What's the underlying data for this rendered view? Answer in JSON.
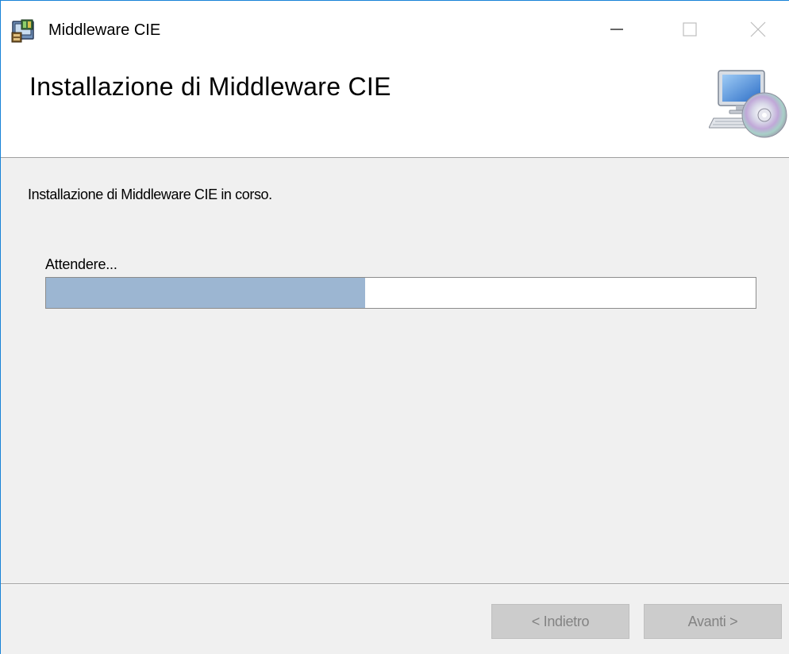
{
  "window": {
    "title": "Middleware CIE",
    "controls": {
      "minimize_icon": "minimize-icon",
      "maximize_icon": "maximize-icon",
      "close_icon": "close-icon"
    }
  },
  "header": {
    "title": "Installazione di Middleware CIE",
    "icon": "computer-disc-icon"
  },
  "body": {
    "status": "Installazione di Middleware CIE in corso.",
    "progress_label": "Attendere...",
    "progress_fraction": 0.45
  },
  "footer": {
    "back_label": "< Indietro",
    "next_label": "Avanti >"
  },
  "colors": {
    "accent_border": "#1883d7",
    "progress_fill": "#9cb6d2",
    "disabled_button_bg": "#cccccc",
    "disabled_button_text": "#838383"
  }
}
